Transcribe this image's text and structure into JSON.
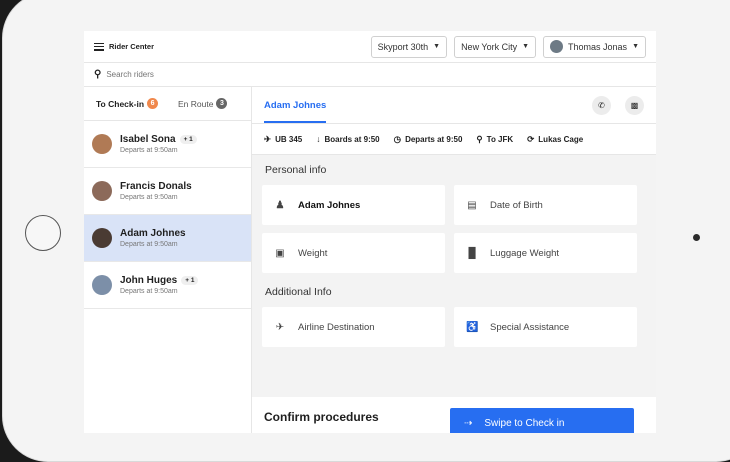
{
  "app": {
    "title": "Rider Center"
  },
  "header": {
    "facility": "Skyport 30th",
    "city": "New York City",
    "user": "Thomas Jonas"
  },
  "search": {
    "placeholder": "Search riders"
  },
  "tabs": [
    {
      "label": "To Check-in",
      "count": "6"
    },
    {
      "label": "En Route",
      "count": "3"
    }
  ],
  "riders": [
    {
      "name": "Isabel Sona",
      "extra": "+ 1",
      "sub": "Departs at 9:50am",
      "avatar_color": "#b07a55"
    },
    {
      "name": "Francis Donals",
      "extra": "",
      "sub": "Departs at 9:50am",
      "avatar_color": "#8c6a5a"
    },
    {
      "name": "Adam Johnes",
      "extra": "",
      "sub": "Departs at 9:50am",
      "avatar_color": "#4a3b33"
    },
    {
      "name": "John Huges",
      "extra": "+ 1",
      "sub": "Departs at 9:50am",
      "avatar_color": "#7c8fa8"
    }
  ],
  "selected_rider": "Adam Johnes",
  "trip": {
    "flight": "UB 345",
    "boards": "Boards at 9:50",
    "departs": "Departs at 9:50",
    "destination": "To JFK",
    "pilot": "Lukas Cage"
  },
  "personal_info": {
    "title": "Personal info",
    "name_value": "Adam Johnes",
    "dob_placeholder": "Date of Birth",
    "weight_placeholder": "Weight",
    "luggage_placeholder": "Luggage Weight"
  },
  "additional_info": {
    "title": "Additional Info",
    "destination_placeholder": "Airline Destination",
    "assistance_placeholder": "Special Assistance"
  },
  "confirm": {
    "title": "Confirm procedures",
    "swipe_label": "Swipe to Check in"
  },
  "colors": {
    "accent": "#276ef1",
    "badge_orange": "#f0884c",
    "selected_bg": "#d9e3f7"
  }
}
